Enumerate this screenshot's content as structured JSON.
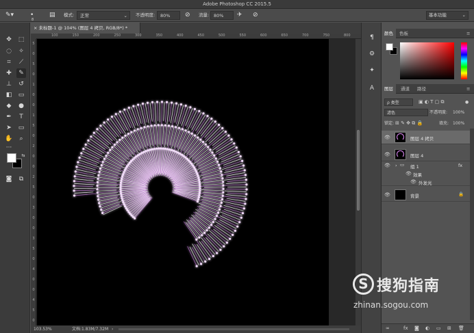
{
  "app": {
    "title": "Adobe Photoshop CC 2015.5"
  },
  "options_bar": {
    "brush_size": "8",
    "mode_label": "模式:",
    "mode_value": "正常",
    "opacity_label": "不透明度:",
    "opacity_value": "80%",
    "flow_label": "流量:",
    "flow_value": "80%",
    "workspace": "基本功能"
  },
  "document": {
    "tab_title": "未标题-1 @ 104% (图层 4 拷贝, RGB/8*) *",
    "zoom": "103.53%",
    "doc_size": "文档:1.83M/7.32M",
    "ruler_top": [
      "100",
      "150",
      "200",
      "250",
      "300",
      "350",
      "400",
      "450",
      "500",
      "550",
      "600",
      "650",
      "700",
      "750",
      "800"
    ],
    "ruler_left": [
      "5",
      "0",
      "5",
      "0",
      "1",
      "0",
      "0",
      "1",
      "5",
      "0",
      "2",
      "0",
      "0",
      "2",
      "5",
      "0",
      "3",
      "0",
      "0",
      "3",
      "5",
      "0",
      "4",
      "0",
      "0",
      "4",
      "5",
      "0"
    ]
  },
  "color_panel": {
    "tabs": [
      "颜色",
      "色板"
    ]
  },
  "layers_panel": {
    "tabs": [
      "图层",
      "通道",
      "路径"
    ],
    "filter_kind": "ρ 类型",
    "blend_mode": "滤色",
    "opacity_label": "不透明度:",
    "opacity_value": "100%",
    "lock_label": "锁定:",
    "fill_label": "填充:",
    "fill_value": "100%",
    "layers": [
      {
        "name": "图层 4 拷贝",
        "selected": true
      },
      {
        "name": "图层 4",
        "selected": false
      },
      {
        "name": "组 1",
        "selected": false,
        "fx": "fx"
      },
      {
        "name": "效果",
        "selected": false
      },
      {
        "name": "外发光",
        "selected": false
      },
      {
        "name": "背景",
        "selected": false
      }
    ]
  },
  "watermark": {
    "text": "搜狗指南",
    "logo": "S",
    "url": "zhinan.sogou.com"
  },
  "colors": {
    "foreground": "#ffffff",
    "background": "#000000",
    "glow": "#c77bdc"
  }
}
